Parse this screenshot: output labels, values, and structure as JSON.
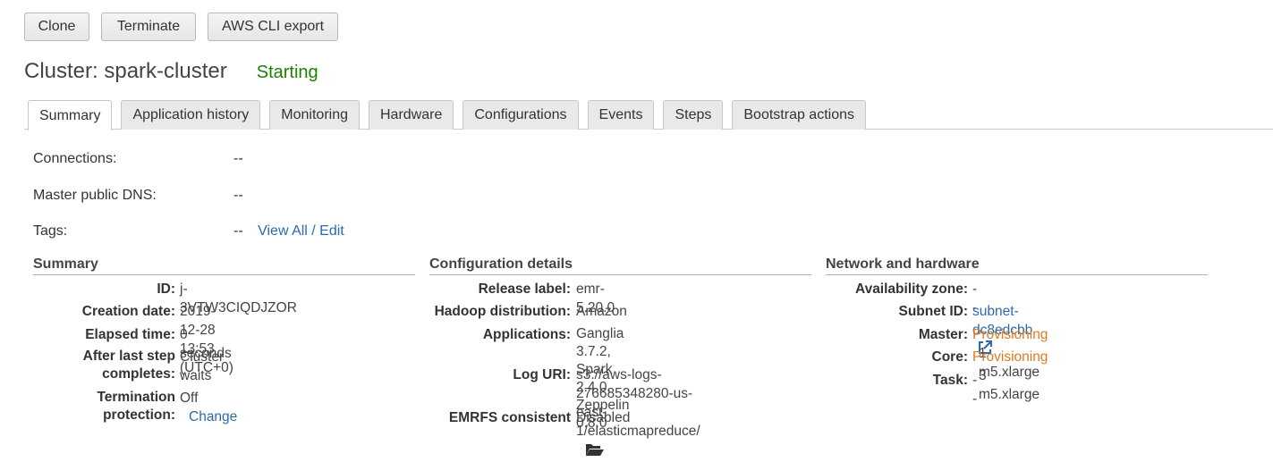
{
  "toolbar": {
    "clone": "Clone",
    "terminate": "Terminate",
    "cli_export": "AWS CLI export"
  },
  "header": {
    "title": "Cluster: spark-cluster",
    "status": "Starting",
    "status_color": "#1d8102"
  },
  "tabs": [
    "Summary",
    "Application history",
    "Monitoring",
    "Hardware",
    "Configurations",
    "Events",
    "Steps",
    "Bootstrap actions"
  ],
  "top_fields": {
    "connections_label": "Connections:",
    "connections_value": "--",
    "dns_label": "Master public DNS:",
    "dns_value": "--",
    "tags_label": "Tags:",
    "tags_value": "--",
    "tags_link": "View All / Edit"
  },
  "summary": {
    "title": "Summary",
    "id_label": "ID:",
    "id_value": "j-3VTW3CIQDJZOR",
    "created_label": "Creation date:",
    "created_value": "2019-12-28 13:53 (UTC+0)",
    "elapsed_label": "Elapsed time:",
    "elapsed_value": "0 seconds",
    "after_label_1": "After last step",
    "after_label_2": "completes:",
    "after_value": "Cluster waits",
    "term_label_1": "Termination",
    "term_label_2": "protection:",
    "term_value": "Off",
    "term_link": "Change"
  },
  "config": {
    "title": "Configuration details",
    "release_label": "Release label:",
    "release_value": "emr-5.20.0",
    "hadoop_label": "Hadoop distribution:",
    "hadoop_value": "Amazon",
    "apps_label": "Applications:",
    "apps_value_1": "Ganglia 3.7.2, Spark 2.4.0, Zeppelin",
    "apps_value_2": "0.8.0",
    "log_label": "Log URI:",
    "log_value_1": "s3://aws-logs-276685348280-us-",
    "log_value_2": "east-1/elasticmapreduce/",
    "emrfs_label": "EMRFS consistent",
    "emrfs_value": "Disabled"
  },
  "network": {
    "title": "Network and hardware",
    "az_label": "Availability zone:",
    "az_value": "--",
    "subnet_label": "Subnet ID:",
    "subnet_value": "subnet-dc8edcbb",
    "master_label": "Master:",
    "master_status": "Provisioning",
    "master_count": "1",
    "master_type": "m5.xlarge",
    "core_label": "Core:",
    "core_status": "Provisioning",
    "core_count": "3",
    "core_type": "m5.xlarge",
    "task_label": "Task:",
    "task_value": "--"
  },
  "icons": {
    "external_link": "external-link-icon",
    "folder": "folder-open-icon"
  },
  "colors": {
    "link": "#2b6ab0",
    "provisioning": "#dd7a1f"
  }
}
